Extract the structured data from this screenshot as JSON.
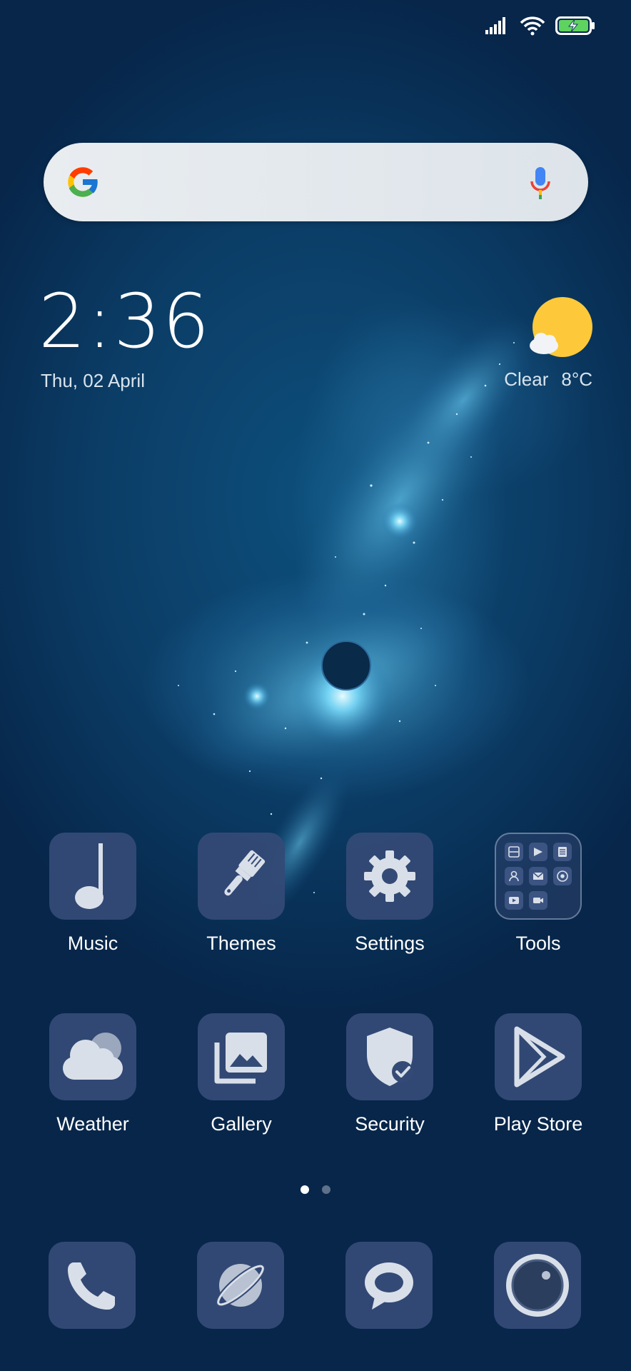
{
  "clock": {
    "time": "2:36",
    "date": "Thu, 02 April"
  },
  "weather_widget": {
    "condition": "Clear",
    "temperature": "8°C",
    "icon": "sun-cloud-icon"
  },
  "search": {
    "logo": "google-g-icon",
    "mic": "mic-icon"
  },
  "status_icons": [
    "signal-icon",
    "wifi-icon",
    "battery-charging-icon"
  ],
  "apps_row1": [
    {
      "label": "Music",
      "icon": "music-note-icon"
    },
    {
      "label": "Themes",
      "icon": "paintbrush-icon"
    },
    {
      "label": "Settings",
      "icon": "gear-icon"
    },
    {
      "label": "Tools",
      "icon": "folder-icon"
    }
  ],
  "apps_row2": [
    {
      "label": "Weather",
      "icon": "cloud-icon"
    },
    {
      "label": "Gallery",
      "icon": "gallery-icon"
    },
    {
      "label": "Security",
      "icon": "shield-check-icon"
    },
    {
      "label": "Play Store",
      "icon": "play-store-icon"
    }
  ],
  "dock": [
    {
      "icon": "phone-icon"
    },
    {
      "icon": "browser-planet-icon"
    },
    {
      "icon": "messages-icon"
    },
    {
      "icon": "camera-icon"
    }
  ],
  "pages": {
    "count": 2,
    "active": 1
  },
  "colors": {
    "tile": "#344a76",
    "sun": "#fdc93a",
    "icon_light": "#d9dfe9"
  }
}
